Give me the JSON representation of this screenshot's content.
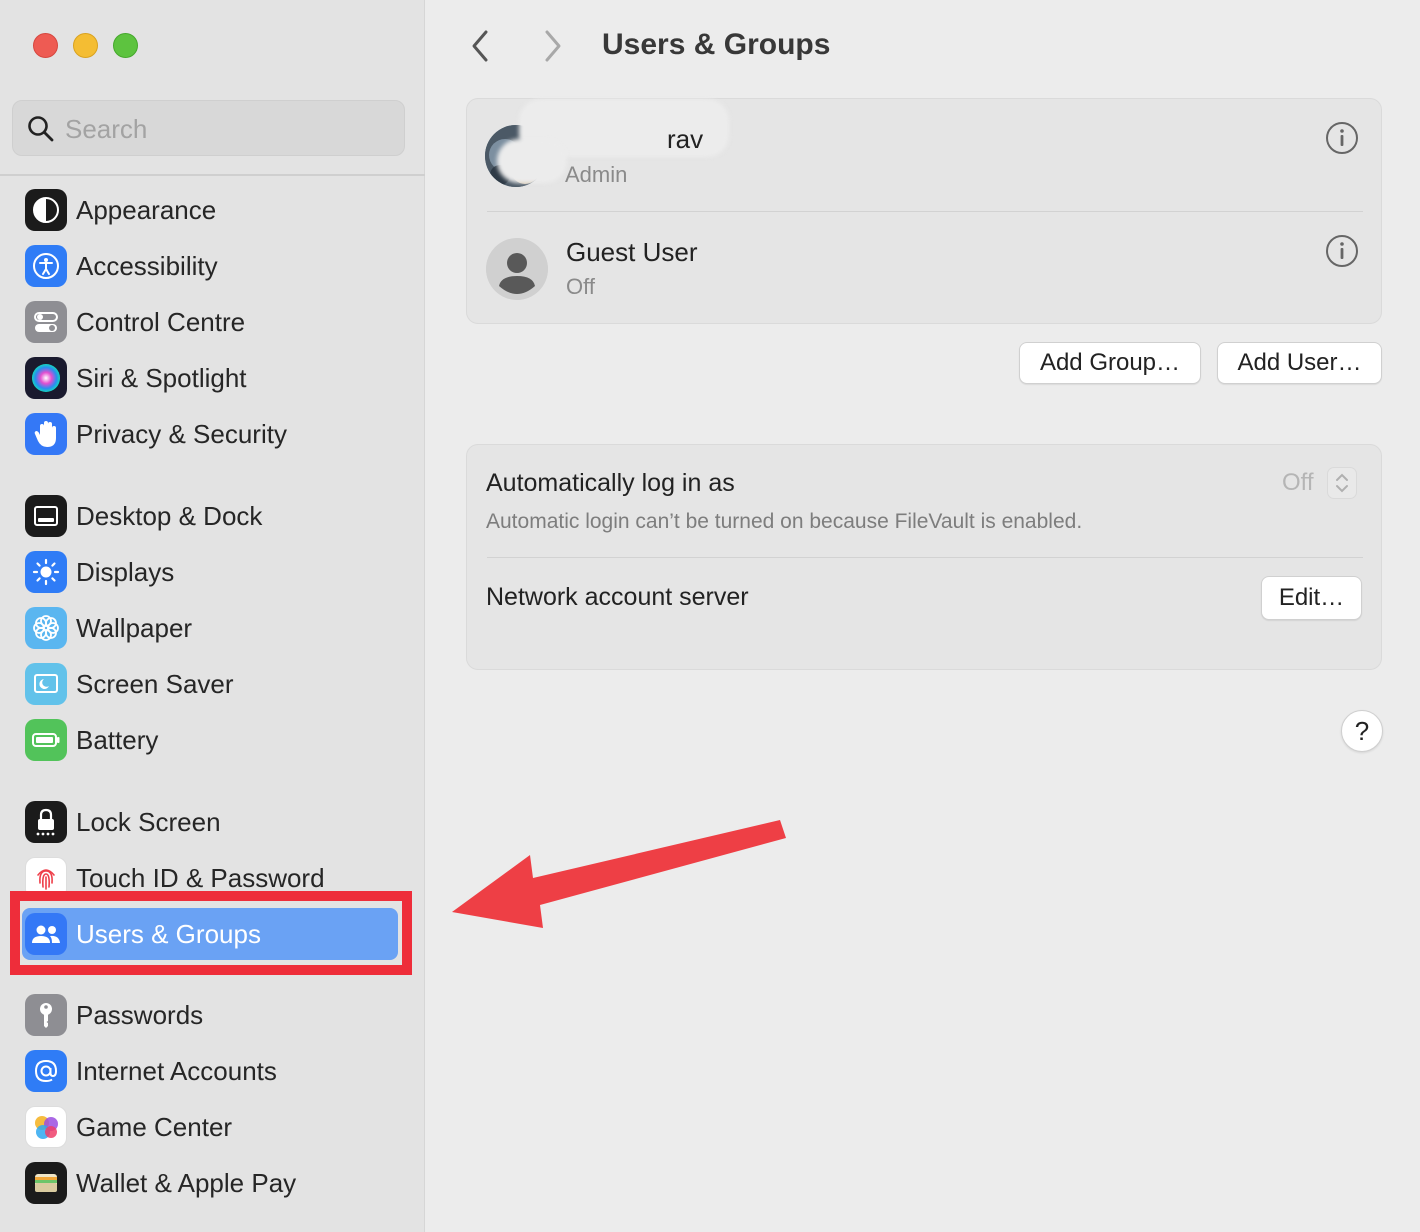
{
  "window": {
    "title": "Users & Groups"
  },
  "search": {
    "placeholder": "Search"
  },
  "sidebar": {
    "items": [
      {
        "label": "Appearance",
        "icon": "appearance-icon"
      },
      {
        "label": "Accessibility",
        "icon": "accessibility-icon"
      },
      {
        "label": "Control Centre",
        "icon": "control-centre-icon"
      },
      {
        "label": "Siri & Spotlight",
        "icon": "siri-icon"
      },
      {
        "label": "Privacy & Security",
        "icon": "hand-icon"
      },
      {
        "label": "Desktop & Dock",
        "icon": "desktop-dock-icon"
      },
      {
        "label": "Displays",
        "icon": "sun-icon"
      },
      {
        "label": "Wallpaper",
        "icon": "flower-icon"
      },
      {
        "label": "Screen Saver",
        "icon": "screen-saver-icon"
      },
      {
        "label": "Battery",
        "icon": "battery-icon"
      },
      {
        "label": "Lock Screen",
        "icon": "lock-icon"
      },
      {
        "label": "Touch ID & Password",
        "icon": "fingerprint-icon"
      },
      {
        "label": "Users & Groups",
        "icon": "users-icon",
        "selected": true
      },
      {
        "label": "Passwords",
        "icon": "key-icon"
      },
      {
        "label": "Internet Accounts",
        "icon": "at-icon"
      },
      {
        "label": "Game Center",
        "icon": "game-center-icon"
      },
      {
        "label": "Wallet & Apple Pay",
        "icon": "wallet-icon"
      }
    ]
  },
  "users": [
    {
      "name": "rav",
      "role": "Admin"
    },
    {
      "name": "Guest User",
      "role": "Off"
    }
  ],
  "actions": {
    "add_group": "Add Group…",
    "add_user": "Add User…"
  },
  "login": {
    "auto_login_label": "Automatically log in as",
    "auto_login_value": "Off",
    "auto_login_note": "Automatic login can’t be turned on because FileVault is enabled.",
    "network_label": "Network account server",
    "edit_label": "Edit…"
  },
  "help": {
    "label": "?"
  },
  "colors": {
    "selection": "#6aa2f4",
    "annotation_red": "#ee2d3a"
  }
}
